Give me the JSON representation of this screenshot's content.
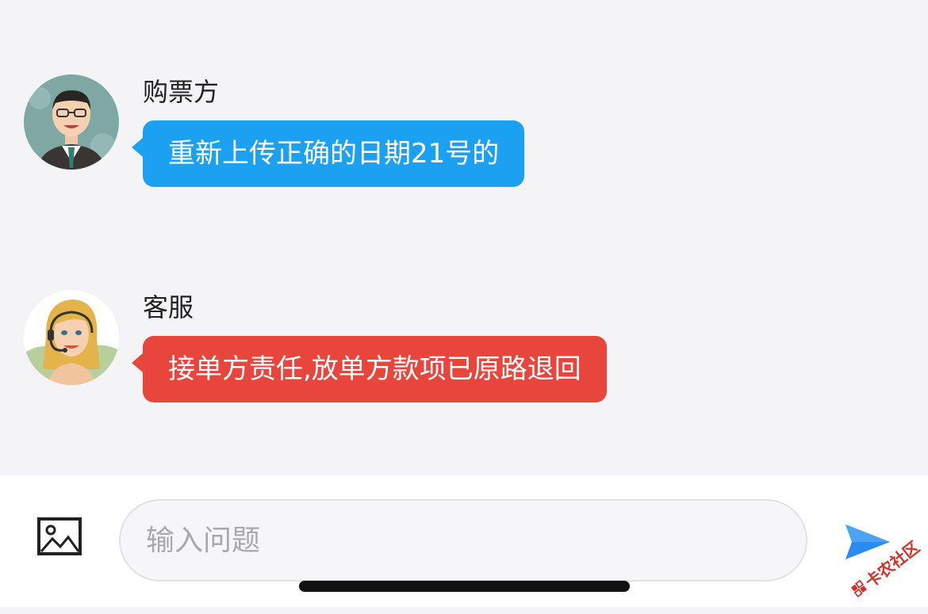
{
  "messages": [
    {
      "sender": "购票方",
      "text": "重新上传正确的日期21号的",
      "bubble_color": "#1ca0f2",
      "avatar_icon": "businessman-avatar-icon"
    },
    {
      "sender": "客服",
      "text": "接单方责任,放单方款项已原路退回",
      "bubble_color": "#e8453c",
      "avatar_icon": "customer-service-avatar-icon"
    }
  ],
  "input_bar": {
    "placeholder": "输入问题",
    "value": "",
    "image_icon": "image-upload-icon",
    "send_icon": "send-arrow-icon",
    "send_color": "#2a8cf0"
  },
  "watermark": {
    "text": "卡农社区",
    "color": "#d3302a"
  }
}
